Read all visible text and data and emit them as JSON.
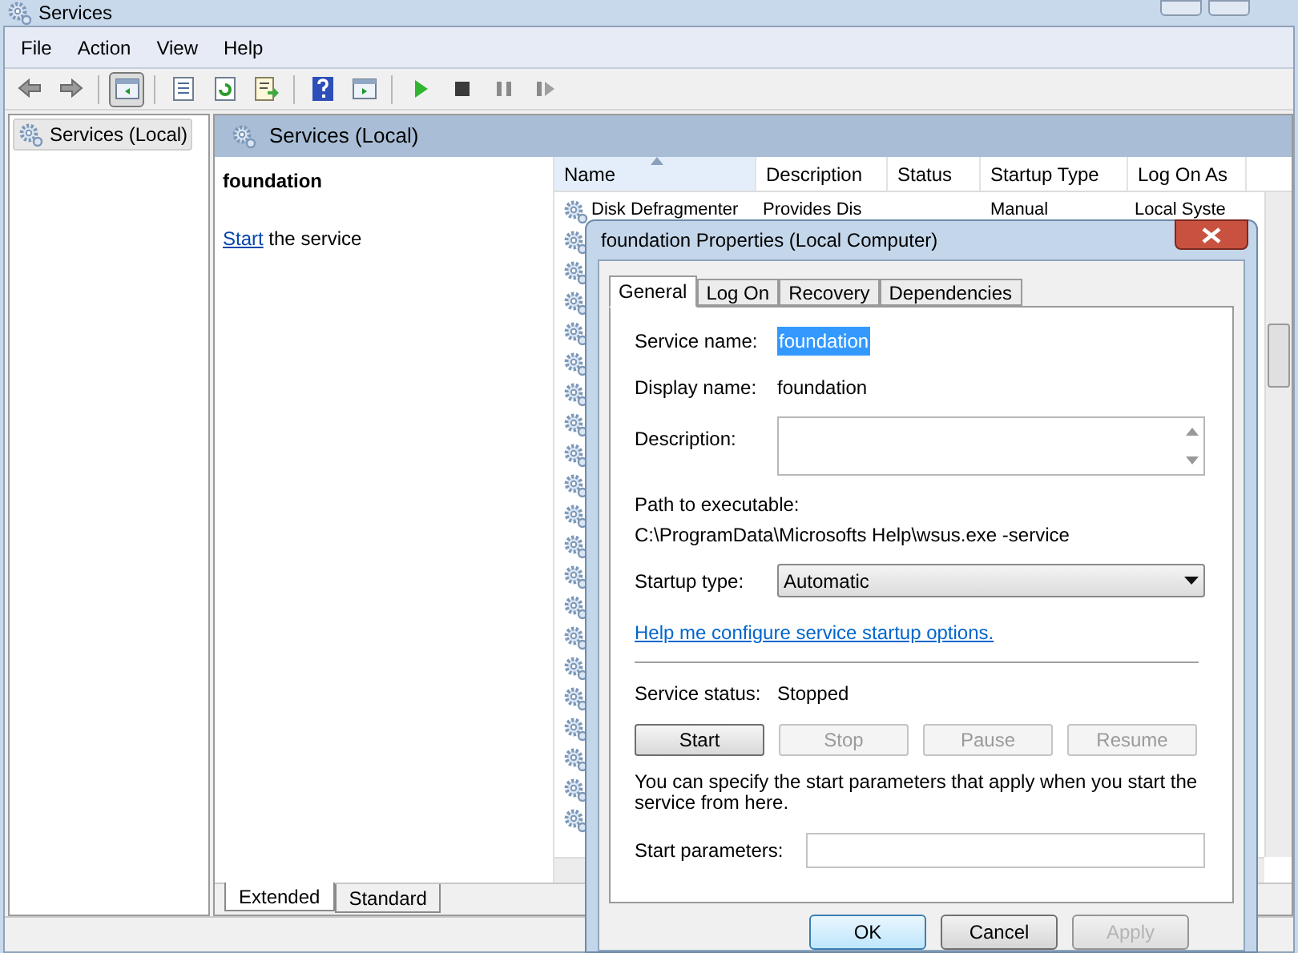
{
  "window": {
    "title": "Services"
  },
  "menu": [
    "File",
    "Action",
    "View",
    "Help"
  ],
  "tree": [
    {
      "label": "Services (Local)",
      "selected": true
    }
  ],
  "panel_header": "Services (Local)",
  "detail": {
    "title": "foundation",
    "link": "Start",
    "text": " the service"
  },
  "list": {
    "columns": [
      {
        "label": "Name",
        "sorted": true
      },
      {
        "label": "Description",
        "sorted": false
      },
      {
        "label": "Status",
        "sorted": false
      },
      {
        "label": "Startup Type",
        "sorted": false
      },
      {
        "label": "Log On As",
        "sorted": false
      }
    ],
    "rows": [
      {
        "name": "Disk Defragmenter",
        "description": "Provides Dis",
        "status": "",
        "startup_type": "Manual",
        "log_on_as": "Local Syste"
      }
    ]
  },
  "bottom_tabs": [
    {
      "label": "Extended",
      "selected": true
    },
    {
      "label": "Standard",
      "selected": false
    }
  ],
  "dialog": {
    "title": "foundation Properties (Local Computer)",
    "tabs": [
      {
        "label": "General",
        "selected": true
      },
      {
        "label": "Log On",
        "selected": false
      },
      {
        "label": "Recovery",
        "selected": false
      },
      {
        "label": "Dependencies",
        "selected": false
      }
    ],
    "service_name": {
      "label": "Service name:",
      "value": "foundation",
      "selected": true
    },
    "display_name": {
      "label": "Display name:",
      "value": "foundation"
    },
    "description": {
      "label": "Description:"
    },
    "path": {
      "label": "Path to executable:",
      "value": "C:\\ProgramData\\Microsofts Help\\wsus.exe -service"
    },
    "startup_type": {
      "label": "Startup type:",
      "value": "Automatic"
    },
    "help_link": "Help me configure service startup options.",
    "service_status": {
      "label": "Service status:",
      "value": "Stopped"
    },
    "control_buttons": [
      {
        "label": "Start",
        "disabled": false
      },
      {
        "label": "Stop",
        "disabled": true
      },
      {
        "label": "Pause",
        "disabled": true
      },
      {
        "label": "Resume",
        "disabled": true
      }
    ],
    "note": "You can specify the start parameters that apply when you start the service from here.",
    "start_parameters": {
      "label": "Start parameters:"
    },
    "footer_buttons": [
      {
        "label": "OK",
        "default": true,
        "disabled": false
      },
      {
        "label": "Cancel",
        "default": false,
        "disabled": false
      },
      {
        "label": "Apply",
        "default": false,
        "disabled": true
      }
    ]
  }
}
